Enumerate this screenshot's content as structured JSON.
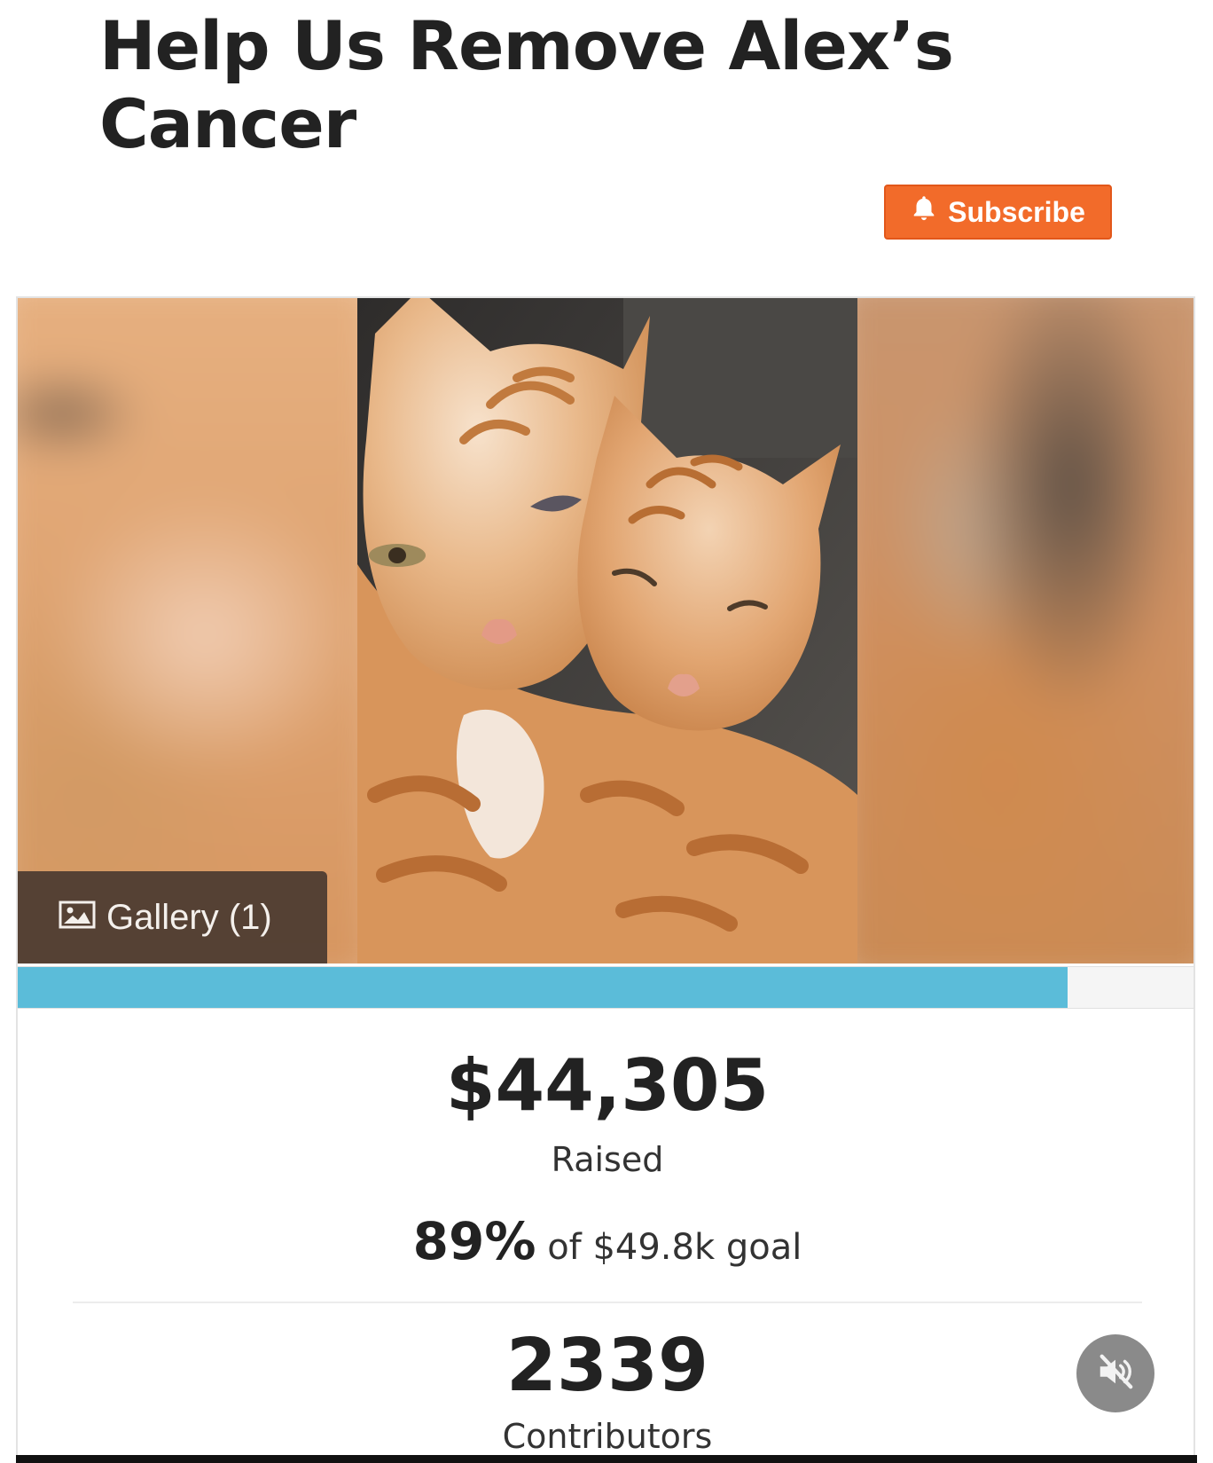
{
  "campaign": {
    "title": "Help Us Remove Alex’s Cancer",
    "subscribe_label": "Subscribe"
  },
  "gallery": {
    "label": "Gallery (1)"
  },
  "progress": {
    "fraction": 0.89,
    "fill_color": "#5bbcd9"
  },
  "stats": {
    "raised_amount": "$44,305",
    "raised_label": "Raised",
    "percent": "89%",
    "goal_text": "of $49.8k goal",
    "contributors_count": "2339",
    "contributors_label": "Contributors"
  },
  "icons": {
    "subscribe": "bell-icon",
    "gallery": "image-icon",
    "mute": "speaker-muted-icon"
  },
  "colors": {
    "accent": "#f26b2a",
    "progress": "#5bbcd9"
  }
}
